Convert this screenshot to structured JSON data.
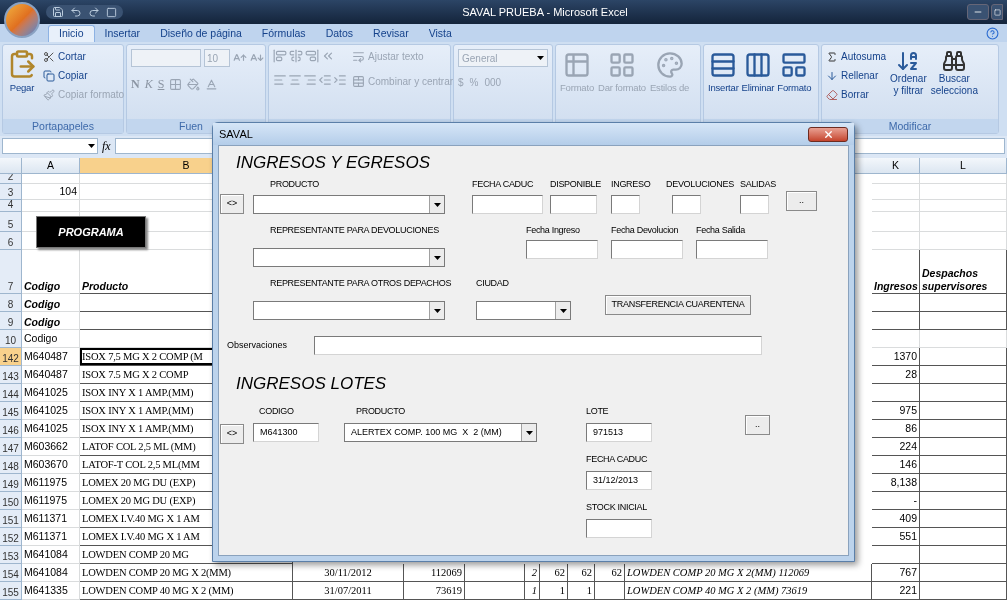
{
  "window": {
    "title": "SAVAL PRUEBA - Microsoft Excel"
  },
  "ribbon_tabs": [
    {
      "label": "Inicio",
      "selected": true
    },
    {
      "label": "Insertar",
      "selected": false
    },
    {
      "label": "Diseño de página",
      "selected": false
    },
    {
      "label": "Fórmulas",
      "selected": false
    },
    {
      "label": "Datos",
      "selected": false
    },
    {
      "label": "Revisar",
      "selected": false
    },
    {
      "label": "Vista",
      "selected": false
    }
  ],
  "ribbon": {
    "clipboard": {
      "paste": "Pegar",
      "cut": "Cortar",
      "copy": "Copiar",
      "format_painter": "Copiar formato",
      "group": "Portapapeles"
    },
    "font": {
      "disabled": true,
      "size": "10",
      "styles": [
        "N",
        "K",
        "S"
      ],
      "group": "Fuen"
    },
    "alignment": {
      "disabled": true,
      "wrap": "Ajustar texto",
      "merge": "Combinar y centrar"
    },
    "number": {
      "disabled": true,
      "format": "General",
      "buttons": [
        "$",
        "%",
        "000"
      ]
    },
    "styles": {
      "disabled": true,
      "buttons": [
        "Formato",
        "Dar formato",
        "Estilos de"
      ]
    },
    "cells": {
      "disabled": false,
      "buttons": [
        "Insertar",
        "Eliminar",
        "Formato"
      ]
    },
    "editing": {
      "autosum": "Autosuma",
      "fill": "Rellenar",
      "clear": "Borrar",
      "sort": [
        "Ordenar",
        "y filtrar"
      ],
      "find": [
        "Buscar",
        "selecciona"
      ],
      "group": "Modificar"
    }
  },
  "formula_bar": {
    "fx": "fx"
  },
  "sheet": {
    "column_headers": {
      "a": {
        "label": "A",
        "selected": false
      },
      "b": {
        "label": "B",
        "selected": true
      },
      "k": {
        "label": "K",
        "selected": false
      },
      "l": {
        "label": "L",
        "selected": false
      }
    },
    "program_button": "PROGRAMA",
    "rows": [
      {
        "number": "2",
        "kind": "plain",
        "selected": false,
        "cells": {}
      },
      {
        "number": "3",
        "kind": "total",
        "selected": false,
        "cells": {
          "a": "104"
        }
      },
      {
        "number": "4",
        "kind": "plain",
        "selected": false,
        "cells": {}
      },
      {
        "number": "5",
        "kind": "plain",
        "selected": false,
        "cells": {}
      },
      {
        "number": "6",
        "kind": "plain",
        "selected": false,
        "cells": {}
      },
      {
        "number": "7",
        "kind": "header",
        "selected": false,
        "cells": {
          "a": "Codigo",
          "b": "Producto",
          "k": "Ingresos",
          "l": "Despachos supervisores"
        }
      },
      {
        "number": "8",
        "kind": "header",
        "selected": false,
        "cells": {
          "a": "Codigo"
        }
      },
      {
        "number": "9",
        "kind": "header",
        "selected": false,
        "cells": {
          "a": "Codigo"
        }
      },
      {
        "number": "10",
        "kind": "plain",
        "selected": false,
        "cells": {
          "a": "Codigo"
        }
      },
      {
        "number": "142",
        "kind": "data",
        "selected": true,
        "cells": {
          "a": "M640487",
          "b": "ISOX 7,5 MG X 2 COMP (M",
          "k": "1370"
        }
      },
      {
        "number": "143",
        "kind": "data",
        "selected": false,
        "cells": {
          "a": "M640487",
          "b": "ISOX 7.5 MG X 2 COMP",
          "k": "28"
        }
      },
      {
        "number": "144",
        "kind": "data",
        "selected": false,
        "cells": {
          "a": "M641025",
          "b": "ISOX INY X 1 AMP.(MM)"
        }
      },
      {
        "number": "145",
        "kind": "data",
        "selected": false,
        "cells": {
          "a": "M641025",
          "b": "ISOX INY X 1 AMP.(MM)",
          "k": "975"
        }
      },
      {
        "number": "146",
        "kind": "data",
        "selected": false,
        "cells": {
          "a": "M641025",
          "b": "ISOX INY X 1 AMP.(MM)",
          "k": "86"
        }
      },
      {
        "number": "147",
        "kind": "data",
        "selected": false,
        "cells": {
          "a": "M603662",
          "b": "LATOF COL 2,5 ML (MM)",
          "k": "224"
        }
      },
      {
        "number": "148",
        "kind": "data",
        "selected": false,
        "cells": {
          "a": "M603670",
          "b": "LATOF-T COL 2,5 ML(MM",
          "k": "146"
        }
      },
      {
        "number": "149",
        "kind": "data",
        "selected": false,
        "cells": {
          "a": "M611975",
          "b": "LOMEX 20 MG DU (EXP)",
          "k": "8,138"
        }
      },
      {
        "number": "150",
        "kind": "data",
        "selected": false,
        "cells": {
          "a": "M611975",
          "b": "LOMEX 20 MG DU (EXP)",
          "k": "-"
        }
      },
      {
        "number": "151",
        "kind": "data",
        "selected": false,
        "cells": {
          "a": "M611371",
          "b": "LOMEX I.V.40 MG X 1 AM",
          "k": "409"
        }
      },
      {
        "number": "152",
        "kind": "data",
        "selected": false,
        "cells": {
          "a": "M611371",
          "b": "LOMEX I.V.40 MG X 1 AM",
          "k": "551"
        }
      },
      {
        "number": "153",
        "kind": "data",
        "selected": false,
        "cells": {
          "a": "M641084",
          "b": "LOWDEN COMP 20 MG"
        }
      },
      {
        "number": "154",
        "kind": "data",
        "selected": false,
        "cells": {
          "a": "M641084",
          "b": "LOWDEN COMP 20 MG X 2(MM)",
          "c": "30/11/2012",
          "d": "112069",
          "f": "2",
          "g": "62",
          "h": "62",
          "i": "62",
          "j": "LOWDEN COMP 20 MG X 2(MM) 112069",
          "k": "767"
        }
      },
      {
        "number": "155",
        "kind": "data",
        "selected": false,
        "cells": {
          "a": "M641335",
          "b": "LOWDEN COMP 40 MG X 2 (MM)",
          "c": "31/07/2011",
          "d": "73619",
          "f": "1",
          "g": "1",
          "h": "1",
          "j": "LOWDEN COMP 40 MG X 2 (MM) 73619",
          "k": "221"
        }
      }
    ]
  },
  "dialog": {
    "title": "SAVAL",
    "movements": {
      "heading": "INGRESOS Y EGRESOS",
      "swap_button": "<>",
      "product": "PRODUCTO",
      "expiry_date": "FECHA CADUC",
      "available": "DISPONIBLE",
      "income": "INGRESO",
      "returns": "DEVOLUCIONES",
      "outputs": "SALIDAS",
      "more_button": "..",
      "returns_rep": "REPRESENTANTE PARA DEVOLUCIONES",
      "income_date": "Fecha Ingreso",
      "return_date": "Fecha Devolucion",
      "output_date": "Fecha Salida",
      "dispatch_rep": "REPRESENTANTE PARA OTROS DEPACHOS",
      "city": "CIUDAD",
      "transfer_button": "TRANSFERENCIA CUARENTENA",
      "notes": "Observaciones"
    },
    "lots": {
      "heading": "INGRESOS LOTES",
      "swap_button": "<>",
      "code": {
        "label": "CODIGO",
        "value": "M641300"
      },
      "product": {
        "label": "PRODUCTO",
        "value": "ALERTEX COMP. 100 MG  X  2 (MM)"
      },
      "lot": {
        "label": "LOTE",
        "value": "971513"
      },
      "expiry_date": {
        "label": "FECHA CADUC",
        "value": "31/12/2013"
      },
      "initial_stock": {
        "label": "STOCK INICIAL"
      },
      "more_button": ".."
    }
  }
}
